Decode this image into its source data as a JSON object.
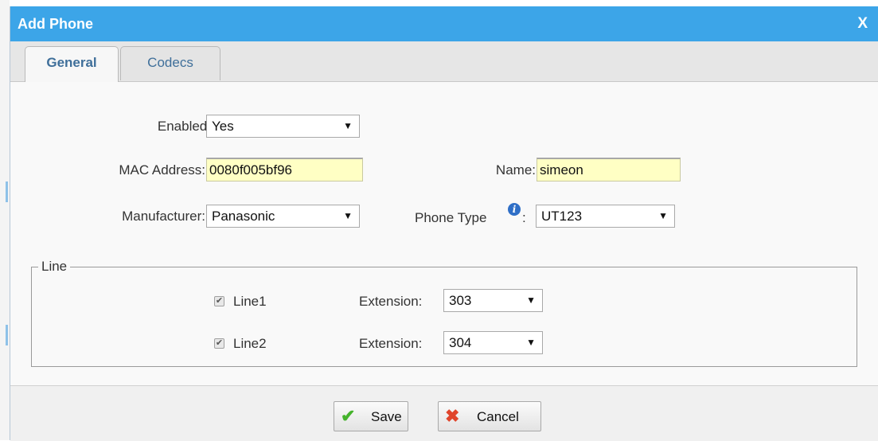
{
  "dialog": {
    "title": "Add Phone",
    "close_label": "X",
    "accent_color": "#3ca5e8"
  },
  "tabs": [
    {
      "label": "General",
      "active": true
    },
    {
      "label": "Codecs",
      "active": false
    }
  ],
  "form": {
    "enabled": {
      "label": "Enabled:",
      "value": "Yes"
    },
    "mac_address": {
      "label": "MAC Address:",
      "value": "0080f005bf96"
    },
    "name": {
      "label": "Name:",
      "value": "simeon"
    },
    "manufacturer": {
      "label": "Manufacturer:",
      "value": "Panasonic"
    },
    "phone_type": {
      "label": "Phone Type",
      "colon": ":",
      "value": "UT123",
      "info_icon": "info-icon"
    }
  },
  "line_group": {
    "legend": "Line",
    "lines": [
      {
        "label": "Line1",
        "checked": true,
        "extension_label": "Extension:",
        "extension": "303"
      },
      {
        "label": "Line2",
        "checked": true,
        "extension_label": "Extension:",
        "extension": "304"
      }
    ]
  },
  "footer": {
    "save_label": "Save",
    "cancel_label": "Cancel",
    "save_icon": "checkmark-icon",
    "cancel_icon": "x-cross-icon"
  }
}
